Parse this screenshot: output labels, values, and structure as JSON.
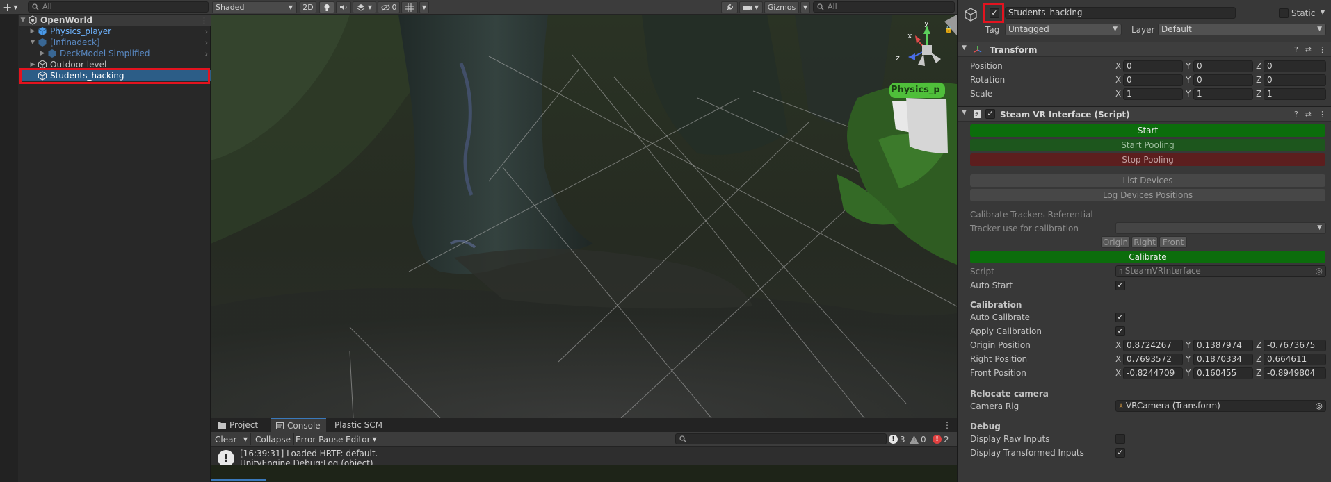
{
  "hierarchy": {
    "search_placeholder": "All",
    "items": [
      {
        "label": "OpenWorld",
        "color": "#d2d2d2"
      },
      {
        "label": "Physics_player",
        "color": "#6fb4ff"
      },
      {
        "label": "[Infinadeck]",
        "color": "#5a8ac4"
      },
      {
        "label": "DeckModel Simplified",
        "color": "#5a8ac4"
      },
      {
        "label": "Outdoor level",
        "color": "#c4c4c4"
      },
      {
        "label": "Students_hacking",
        "color": "#ffffff"
      }
    ]
  },
  "scene": {
    "shading_mode": "Shaded",
    "mode_2d": "2D",
    "hidden_count": "0",
    "gizmos_label": "Gizmos",
    "search_placeholder": "All",
    "gizmo_axes": {
      "x": "x",
      "y": "y",
      "z": "z"
    },
    "label_overlay": "Physics_p"
  },
  "console": {
    "tabs": [
      {
        "label": "Project"
      },
      {
        "label": "Console"
      },
      {
        "label": "Plastic SCM"
      }
    ],
    "toolbar": {
      "clear": "Clear",
      "collapse": "Collapse",
      "error_pause": "Error Pause",
      "editor": "Editor"
    },
    "counts": {
      "info": "3",
      "warnings": "0",
      "errors": "2"
    },
    "log_line_1": "[16:39:31] Loaded HRTF: default.",
    "log_line_2": "UnityEngine.Debug:Log (object)"
  },
  "inspector": {
    "object_name": "Students_hacking",
    "static_label": "Static",
    "tag_label": "Tag",
    "tag_value": "Untagged",
    "layer_label": "Layer",
    "layer_value": "Default",
    "transform": {
      "title": "Transform",
      "rows": [
        {
          "label": "Position",
          "x": "0",
          "y": "0",
          "z": "0"
        },
        {
          "label": "Rotation",
          "x": "0",
          "y": "0",
          "z": "0"
        },
        {
          "label": "Scale",
          "x": "1",
          "y": "1",
          "z": "1"
        }
      ]
    },
    "axis_labels": {
      "x": "X",
      "y": "Y",
      "z": "Z"
    },
    "script_component": {
      "title": "Steam VR Interface (Script)",
      "buttons": {
        "start": "Start",
        "start_pooling": "Start Pooling",
        "stop_pooling": "Stop Pooling",
        "list_devices": "List Devices",
        "log_positions": "Log Devices Positions"
      },
      "calibrate_ref_label": "Calibrate Trackers Referential",
      "tracker_label": "Tracker use for calibration",
      "origin_btn": "Origin",
      "right_btn": "Right",
      "front_btn": "Front",
      "calibrate_btn": "Calibrate",
      "script_label": "Script",
      "script_value": "SteamVRInterface",
      "auto_start_label": "Auto Start",
      "calibration_header": "Calibration",
      "auto_calibrate_label": "Auto Calibrate",
      "apply_calibration_label": "Apply Calibration",
      "origin_position": {
        "label": "Origin Position",
        "x": "0.8724267",
        "y": "0.1387974",
        "z": "-0.7673675"
      },
      "right_position": {
        "label": "Right Position",
        "x": "0.7693572",
        "y": "0.1870334",
        "z": "0.664611"
      },
      "front_position": {
        "label": "Front Position",
        "x": "-0.8244709",
        "y": "0.160455",
        "z": "-0.8949804"
      },
      "relocate_header": "Relocate camera",
      "camera_rig_label": "Camera Rig",
      "camera_rig_value": "VRCamera (Transform)",
      "debug_header": "Debug",
      "display_raw_label": "Display Raw Inputs",
      "display_transformed_label": "Display Transformed Inputs"
    }
  },
  "colors": {
    "start_green": "#0c6d0c",
    "pooling_green": "#1d561d",
    "stop_red": "#5c1e1e",
    "highlight_red": "#e3131f",
    "selection_blue": "#2c5d87"
  }
}
